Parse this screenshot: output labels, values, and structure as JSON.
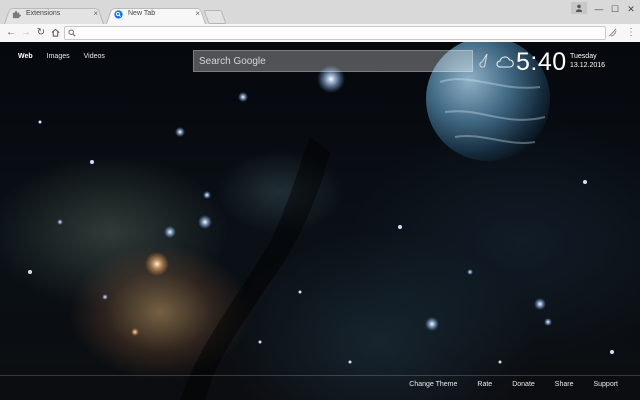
{
  "tabs": [
    {
      "title": "Extensions",
      "close": "×"
    },
    {
      "title": "New Tab",
      "close": "×"
    }
  ],
  "window_controls": {
    "minimize": "—",
    "maximize": "☐",
    "close": "✕"
  },
  "address_bar": {
    "value": "",
    "search_icon": "search-icon"
  },
  "nav_links": [
    "Web",
    "Images",
    "Videos"
  ],
  "search": {
    "placeholder": "Search Google"
  },
  "clock": {
    "time": "5:40",
    "day": "Tuesday",
    "date": "13.12.2016"
  },
  "footer_links": [
    "Change Theme",
    "Rate",
    "Donate",
    "Share",
    "Support"
  ],
  "colors": {
    "chrome_bg": "#eeeeee",
    "tabstrip_bg": "#d9d9d9",
    "google_tab_icon": "#1a73e8"
  }
}
